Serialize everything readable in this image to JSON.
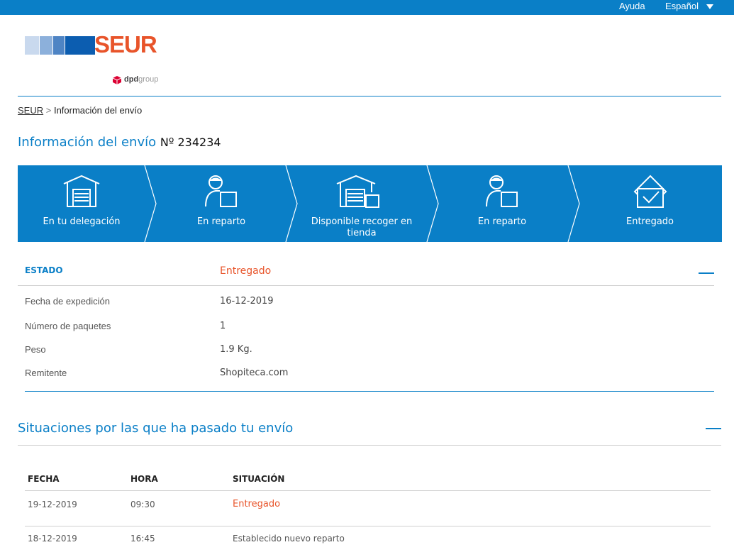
{
  "topbar": {
    "help": "Ayuda",
    "language": "Español"
  },
  "logo": {
    "brand": "SEUR",
    "group_bold": "dpd",
    "group_light": "group"
  },
  "breadcrumb": {
    "home": "SEUR",
    "separator": ">",
    "current": "Información del envío"
  },
  "title": {
    "label": "Información del envío",
    "number": "Nº 234234"
  },
  "steps": [
    {
      "label": "En tu delegación",
      "icon": "warehouse-icon"
    },
    {
      "label": "En reparto",
      "icon": "courier-icon"
    },
    {
      "label": "Disponible recoger en tienda",
      "icon": "store-pickup-icon"
    },
    {
      "label": "En reparto",
      "icon": "courier-icon"
    },
    {
      "label": "Entregado",
      "icon": "delivered-box-icon"
    }
  ],
  "status": {
    "label": "ESTADO",
    "value": "Entregado",
    "rows": [
      {
        "label": "Fecha de expedición",
        "value": "16-12-2019"
      },
      {
        "label": "Número de paquetes",
        "value": "1"
      },
      {
        "label": "Peso",
        "value": "1.9 Kg."
      },
      {
        "label": "Remitente",
        "value": "Shopiteca.com"
      }
    ]
  },
  "history": {
    "title": "Situaciones por las que ha pasado tu envío",
    "columns": [
      "FECHA",
      "HORA",
      "SITUACIÓN"
    ],
    "rows": [
      {
        "date": "19-12-2019",
        "time": "09:30",
        "situation": "Entregado"
      },
      {
        "date": "18-12-2019",
        "time": "16:45",
        "situation": "Establecido nuevo reparto"
      }
    ]
  },
  "colors": {
    "primary": "#0a7fc7",
    "accent": "#e8542a"
  }
}
